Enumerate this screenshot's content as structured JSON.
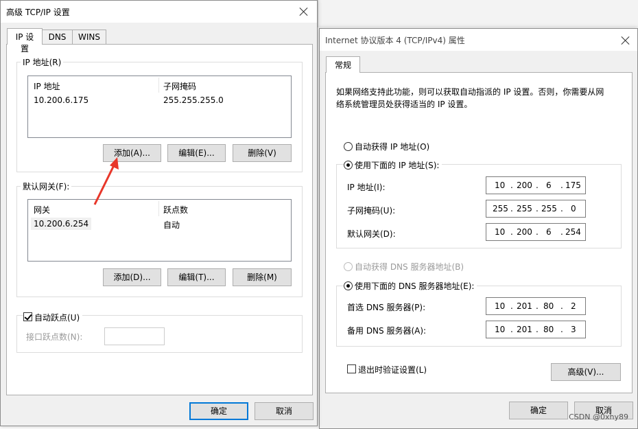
{
  "left_dialog": {
    "title": "高级 TCP/IP 设置",
    "tabs": [
      "IP 设置",
      "DNS",
      "WINS"
    ],
    "ip_group": {
      "label": "IP 地址(R)",
      "columns": [
        "IP 地址",
        "子网掩码"
      ],
      "rows": [
        [
          "10.200.6.175",
          "255.255.255.0"
        ]
      ],
      "buttons": [
        "添加(A)...",
        "编辑(E)...",
        "删除(V)"
      ]
    },
    "gateway_group": {
      "label": "默认网关(F):",
      "columns": [
        "网关",
        "跃点数"
      ],
      "rows": [
        [
          "10.200.6.254",
          "自动"
        ]
      ],
      "buttons": [
        "添加(D)...",
        "编辑(T)...",
        "删除(M)"
      ]
    },
    "auto_metric": {
      "label": "自动跃点(U)",
      "checked": true,
      "interface_metric_label": "接口跃点数(N):"
    },
    "ok": "确定",
    "cancel": "取消"
  },
  "right_dialog": {
    "title": "Internet 协议版本 4 (TCP/IPv4) 属性",
    "tab": "常规",
    "description": [
      "如果网络支持此功能，则可以获取自动指派的 IP 设置。否则，你需要从网",
      "络系统管理员处获得适当的 IP 设置。"
    ],
    "auto_ip": "自动获得 IP 地址(O)",
    "manual_ip": "使用下面的 IP 地址(S):",
    "ip_fields": [
      {
        "label": "IP 地址(I):",
        "octets": [
          "10",
          "200",
          "6",
          "175"
        ]
      },
      {
        "label": "子网掩码(U):",
        "octets": [
          "255",
          "255",
          "255",
          "0"
        ]
      },
      {
        "label": "默认网关(D):",
        "octets": [
          "10",
          "200",
          "6",
          "254"
        ]
      }
    ],
    "auto_dns": "自动获得 DNS 服务器地址(B)",
    "manual_dns": "使用下面的 DNS 服务器地址(E):",
    "dns_fields": [
      {
        "label": "首选 DNS 服务器(P):",
        "octets": [
          "10",
          "201",
          "80",
          "2"
        ]
      },
      {
        "label": "备用 DNS 服务器(A):",
        "octets": [
          "10",
          "201",
          "80",
          "3"
        ]
      }
    ],
    "validate": "退出时验证设置(L)",
    "advanced": "高级(V)...",
    "ok": "确定",
    "cancel": "取消"
  },
  "watermark": "CSDN @0xhy89",
  "colors": {
    "arrow": "#e8372a",
    "focus": "#0078d7"
  }
}
